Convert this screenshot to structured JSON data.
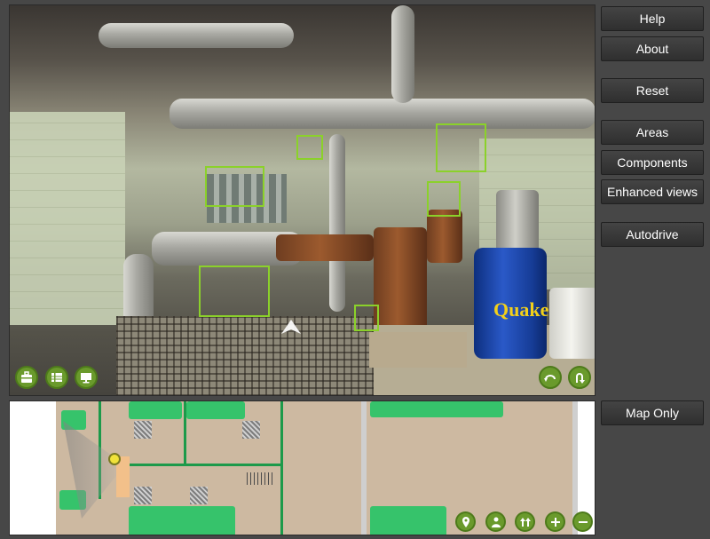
{
  "menu": {
    "help": "Help",
    "about": "About",
    "reset": "Reset",
    "areas": "Areas",
    "components": "Components",
    "enhanced_views": "Enhanced views",
    "autodrive": "Autodrive",
    "map_only": "Map Only"
  },
  "viewer": {
    "barrel_label": "Quake",
    "left_controls": [
      "toolbox-icon",
      "list-view-icon",
      "monitor-icon"
    ],
    "right_controls": [
      "rotate-icon",
      "u-turn-icon"
    ]
  },
  "map": {
    "controls": [
      "map-pin-icon",
      "person-location-icon",
      "double-arrow-up-icon",
      "zoom-in-icon",
      "zoom-out-icon"
    ]
  },
  "colors": {
    "hotspot": "#8bd12a",
    "control_green": "#6a9a2c",
    "map_wall": "#1c9a4a",
    "map_equipment": "#36c36b",
    "map_floor": "#cdb9a1",
    "menu_bg": "#3a3a3a"
  }
}
